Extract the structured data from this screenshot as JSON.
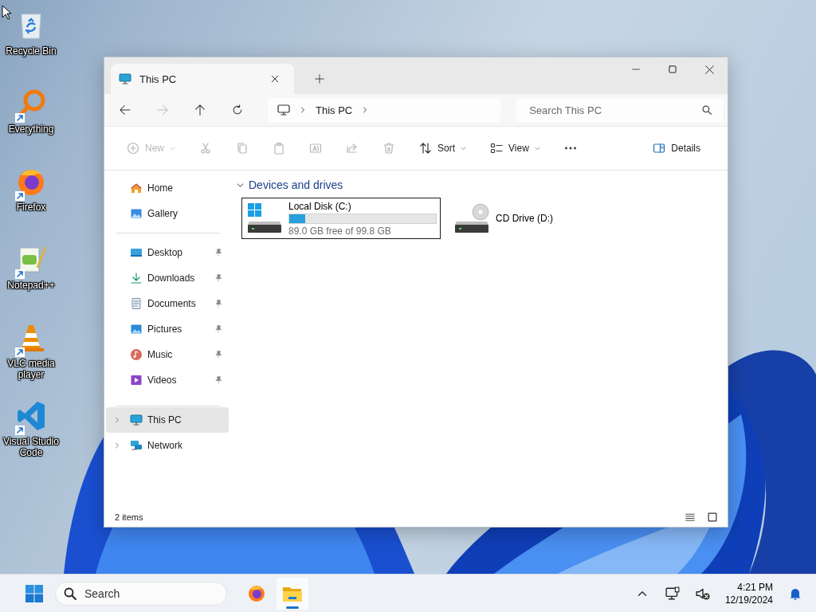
{
  "desktop_icons": [
    {
      "label": "Recycle Bin",
      "kind": "recycle",
      "shortcut": false
    },
    {
      "label": "Everything",
      "kind": "everything",
      "shortcut": true
    },
    {
      "label": "Firefox",
      "kind": "firefox",
      "shortcut": true
    },
    {
      "label": "Notepad++",
      "kind": "notepad",
      "shortcut": true
    },
    {
      "label": "VLC media player",
      "kind": "vlc",
      "shortcut": true
    },
    {
      "label": "Visual Studio Code",
      "kind": "vscode",
      "shortcut": true
    }
  ],
  "window": {
    "tabs": [
      {
        "title": "This PC",
        "selected": true
      }
    ],
    "breadcrumb": [
      "This PC"
    ],
    "search": {
      "placeholder": "Search This PC"
    },
    "toolbar": [
      {
        "kind": "new",
        "label": "New",
        "disabled": true,
        "dropdown": true
      },
      {
        "kind": "cut",
        "disabled": true
      },
      {
        "kind": "copy",
        "disabled": true
      },
      {
        "kind": "paste",
        "disabled": true
      },
      {
        "kind": "rename",
        "disabled": true
      },
      {
        "kind": "share",
        "disabled": true
      },
      {
        "kind": "delete",
        "disabled": true
      },
      {
        "kind": "sort",
        "label": "Sort",
        "disabled": false,
        "dropdown": true
      },
      {
        "kind": "view",
        "label": "View",
        "disabled": false,
        "dropdown": true
      },
      {
        "kind": "more",
        "disabled": false
      }
    ],
    "details": "Details",
    "sidebar": {
      "quick": [
        {
          "label": "Home",
          "kind": "home"
        },
        {
          "label": "Gallery",
          "kind": "gallery"
        }
      ],
      "pinned": [
        {
          "label": "Desktop",
          "kind": "desktop",
          "pinned": true
        },
        {
          "label": "Downloads",
          "kind": "downloads",
          "pinned": true
        },
        {
          "label": "Documents",
          "kind": "documents",
          "pinned": true
        },
        {
          "label": "Pictures",
          "kind": "pictures",
          "pinned": true
        },
        {
          "label": "Music",
          "kind": "music",
          "pinned": true
        },
        {
          "label": "Videos",
          "kind": "videos",
          "pinned": true
        }
      ],
      "tree": [
        {
          "label": "This PC",
          "kind": "pc",
          "selected": true,
          "expanded": false
        },
        {
          "label": "Network",
          "kind": "network",
          "selected": false,
          "expanded": false
        }
      ]
    },
    "section": {
      "title": "Devices and drives",
      "expanded": true,
      "drives": [
        {
          "label": "Local Disk (C:)",
          "kind": "system",
          "selected": true,
          "level": 0.108,
          "reading": "89.0 GB free of 99.8 GB"
        },
        {
          "label": "CD Drive (D:)",
          "kind": "cd",
          "selected": false
        }
      ]
    },
    "status_bar": {
      "count": "2 items"
    }
  },
  "taskbar": {
    "search": {
      "placeholder": "Search"
    },
    "apps": [
      {
        "kind": "firefox",
        "active": false
      },
      {
        "kind": "explorer",
        "active": true
      }
    ],
    "time": "4:21 PM",
    "date": "12/19/2024"
  }
}
